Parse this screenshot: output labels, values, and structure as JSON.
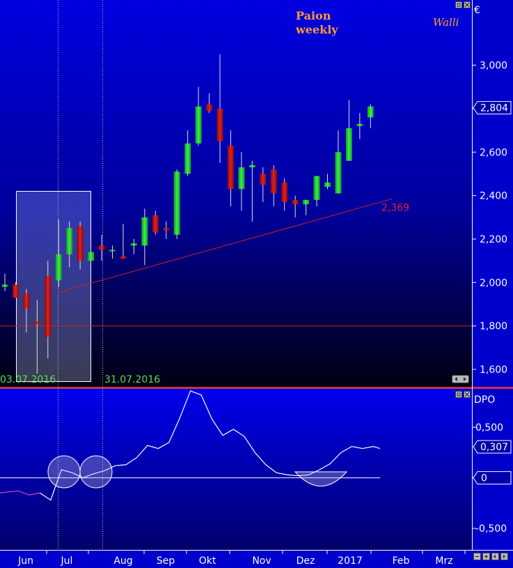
{
  "chart_data": [
    {
      "type": "candlestick",
      "title": "Paion",
      "subtitle": "weekly",
      "brand": "Walli",
      "currency": "€",
      "ylim": [
        1.52,
        3.3
      ],
      "yticks": [
        "1,600",
        "1,800",
        "2,000",
        "2,200",
        "2,400",
        "2,600",
        "2,800",
        "3,000"
      ],
      "last_value": "2,804",
      "trendline_label": "2,369",
      "support_level": 1.8,
      "date_labels": [
        "03.07.2016",
        "31.07.2016"
      ],
      "candles": [
        {
          "o": 1.98,
          "h": 2.04,
          "l": 1.96,
          "c": 1.99
        },
        {
          "o": 1.99,
          "h": 2.0,
          "l": 1.93,
          "c": 1.93
        },
        {
          "o": 1.95,
          "h": 1.97,
          "l": 1.77,
          "c": 1.88
        },
        {
          "o": 1.82,
          "h": 1.92,
          "l": 1.58,
          "c": 1.81
        },
        {
          "o": 2.03,
          "h": 2.1,
          "l": 1.65,
          "c": 1.75
        },
        {
          "o": 2.01,
          "h": 2.29,
          "l": 1.98,
          "c": 2.13
        },
        {
          "o": 2.13,
          "h": 2.28,
          "l": 2.07,
          "c": 2.25
        },
        {
          "o": 2.26,
          "h": 2.28,
          "l": 2.06,
          "c": 2.1
        },
        {
          "o": 2.1,
          "h": 2.2,
          "l": 2.09,
          "c": 2.14
        },
        {
          "o": 2.17,
          "h": 2.22,
          "l": 2.1,
          "c": 2.15
        },
        {
          "o": 2.15,
          "h": 2.17,
          "l": 2.11,
          "c": 2.15
        },
        {
          "o": 2.12,
          "h": 2.27,
          "l": 2.11,
          "c": 2.11
        },
        {
          "o": 2.17,
          "h": 2.2,
          "l": 2.13,
          "c": 2.18
        },
        {
          "o": 2.17,
          "h": 2.34,
          "l": 2.08,
          "c": 2.3
        },
        {
          "o": 2.31,
          "h": 2.33,
          "l": 2.22,
          "c": 2.23
        },
        {
          "o": 2.25,
          "h": 2.28,
          "l": 2.2,
          "c": 2.24
        },
        {
          "o": 2.22,
          "h": 2.52,
          "l": 2.2,
          "c": 2.51
        },
        {
          "o": 2.5,
          "h": 2.7,
          "l": 2.49,
          "c": 2.64
        },
        {
          "o": 2.64,
          "h": 2.9,
          "l": 2.63,
          "c": 2.81
        },
        {
          "o": 2.82,
          "h": 2.87,
          "l": 2.78,
          "c": 2.79
        },
        {
          "o": 2.8,
          "h": 3.05,
          "l": 2.55,
          "c": 2.65
        },
        {
          "o": 2.63,
          "h": 2.7,
          "l": 2.35,
          "c": 2.43
        },
        {
          "o": 2.43,
          "h": 2.6,
          "l": 2.33,
          "c": 2.53
        },
        {
          "o": 2.53,
          "h": 2.56,
          "l": 2.28,
          "c": 2.54
        },
        {
          "o": 2.5,
          "h": 2.53,
          "l": 2.37,
          "c": 2.45
        },
        {
          "o": 2.52,
          "h": 2.54,
          "l": 2.35,
          "c": 2.41
        },
        {
          "o": 2.46,
          "h": 2.48,
          "l": 2.33,
          "c": 2.37
        },
        {
          "o": 2.38,
          "h": 2.4,
          "l": 2.3,
          "c": 2.36
        },
        {
          "o": 2.36,
          "h": 2.38,
          "l": 2.31,
          "c": 2.38
        },
        {
          "o": 2.38,
          "h": 2.48,
          "l": 2.35,
          "c": 2.49
        },
        {
          "o": 2.44,
          "h": 2.5,
          "l": 2.43,
          "c": 2.46
        },
        {
          "o": 2.41,
          "h": 2.7,
          "l": 2.41,
          "c": 2.6
        },
        {
          "o": 2.56,
          "h": 2.84,
          "l": 2.56,
          "c": 2.71
        },
        {
          "o": 2.72,
          "h": 2.78,
          "l": 2.66,
          "c": 2.73
        },
        {
          "o": 2.76,
          "h": 2.82,
          "l": 2.71,
          "c": 2.81
        }
      ]
    },
    {
      "type": "line",
      "title": "DPO",
      "ylim": [
        -0.72,
        0.88
      ],
      "yticks": [
        "-0,500",
        "0",
        "0,500"
      ],
      "last_value": "0,307",
      "zero_label": "0",
      "values": [
        -0.14,
        -0.13,
        -0.17,
        -0.15,
        -0.22,
        0.08,
        0.05,
        0.0,
        0.04,
        0.07,
        0.12,
        0.13,
        0.2,
        0.32,
        0.29,
        0.35,
        0.59,
        0.86,
        0.82,
        0.58,
        0.42,
        0.48,
        0.41,
        0.25,
        0.13,
        0.05,
        0.03,
        0.02,
        0.03,
        0.08,
        0.14,
        0.25,
        0.31,
        0.29,
        0.31
      ]
    }
  ],
  "x_axis": {
    "months": [
      "Jun",
      "Jul",
      "Aug",
      "Sep",
      "Okt",
      "Nov",
      "Dez",
      "2017",
      "Feb",
      "Mrz"
    ]
  },
  "colors": {
    "up": "#22cc33",
    "down": "#cc1111",
    "bg_top": "#0000dd",
    "bg_bottom": "#000000",
    "trend": "#cc2222",
    "dpo": "#ffffff",
    "dpo_low": "#d040d0"
  }
}
